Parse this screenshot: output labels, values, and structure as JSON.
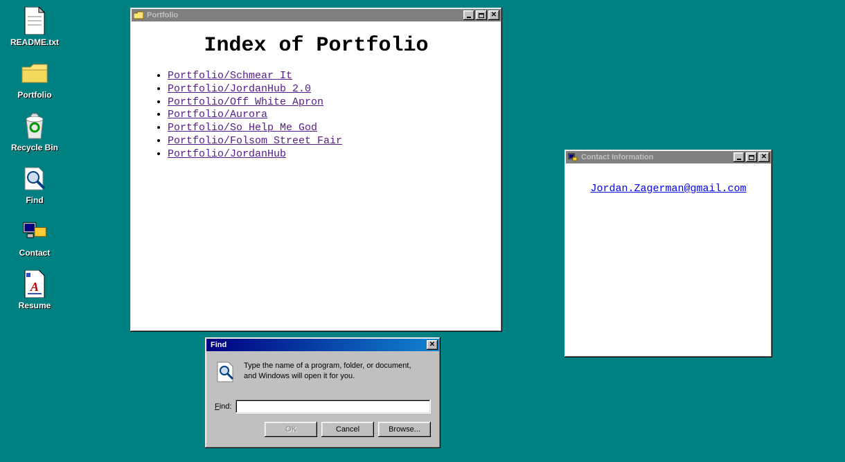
{
  "desktop": {
    "icons": [
      {
        "id": "readme",
        "label": "README.txt"
      },
      {
        "id": "portfolio",
        "label": "Portfolio"
      },
      {
        "id": "recycle",
        "label": "Recycle Bin"
      },
      {
        "id": "find",
        "label": "Find"
      },
      {
        "id": "contact",
        "label": "Contact"
      },
      {
        "id": "resume",
        "label": "Resume"
      }
    ]
  },
  "portfolio_window": {
    "title": "Portfolio",
    "heading": "Index of Portfolio",
    "links": [
      "Portfolio/Schmear It",
      "Portfolio/JordanHub 2.0",
      "Portfolio/Off White Apron",
      "Portfolio/Aurora",
      "Portfolio/So Help Me God",
      "Portfolio/Folsom Street Fair",
      "Portfolio/JordanHub"
    ]
  },
  "contact_window": {
    "title": "Contact Information",
    "email": "Jordan.Zagerman@gmail.com"
  },
  "find_dialog": {
    "title": "Find",
    "message": "Type the name of a program, folder, or document, and Windows will open it for you.",
    "label_html": "Find:",
    "label_underline": "F",
    "input_value": "",
    "buttons": {
      "ok": "OK",
      "cancel": "Cancel",
      "browse": "Browse..."
    }
  }
}
